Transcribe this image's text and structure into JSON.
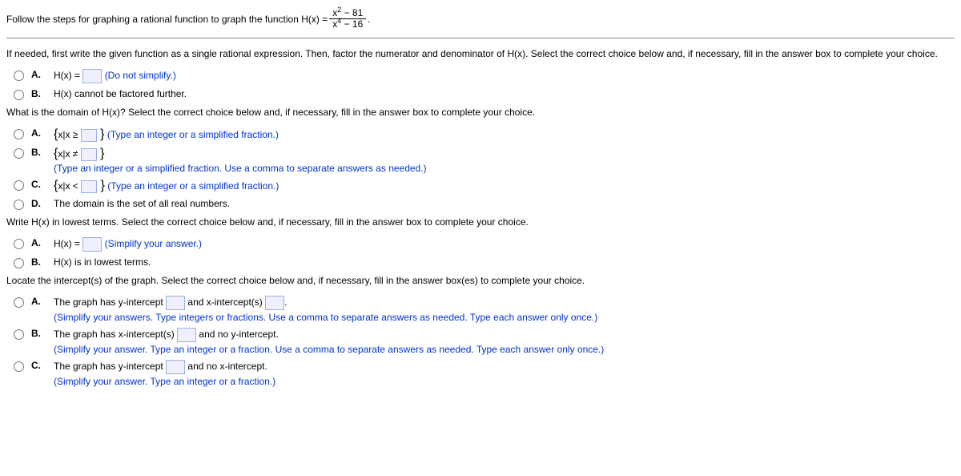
{
  "intro": {
    "lead": "Follow the steps for graphing a rational function to graph the function H(x) =",
    "num": "x",
    "numExp": "2",
    "numTail": " − 81",
    "den": "x",
    "denExp": "4",
    "denTail": " − 16",
    "period": "."
  },
  "q1": {
    "prompt": "If needed, first write the given function as a single rational expression. Then, factor the numerator and denominator of H(x). Select the correct choice below and, if necessary, fill in the answer box to complete your choice.",
    "A": {
      "letter": "A.",
      "pre": "H(x) = ",
      "hint": "(Do not simplify.)"
    },
    "B": {
      "letter": "B.",
      "text": "H(x) cannot be factored further."
    }
  },
  "q2": {
    "prompt": "What is the domain of H(x)? Select the correct choice below and, if necessary, fill in the answer box to complete your choice.",
    "A": {
      "letter": "A.",
      "open": "{",
      "xcond": "x|x ≥ ",
      "close": " }",
      "hint": "(Type an integer or a simplified fraction.)"
    },
    "B": {
      "letter": "B.",
      "open": "{",
      "xcond": "x|x ≠ ",
      "close": " }",
      "hint": "(Type an integer or a simplified fraction. Use a comma to separate answers as needed.)"
    },
    "C": {
      "letter": "C.",
      "open": "{",
      "xcond": "x|x < ",
      "close": " }",
      "hint": "(Type an integer or a simplified fraction.)"
    },
    "D": {
      "letter": "D.",
      "text": "The domain is the set of all real numbers."
    }
  },
  "q3": {
    "prompt": "Write H(x) in lowest terms. Select the correct choice below and, if necessary, fill in the answer box to complete your choice.",
    "A": {
      "letter": "A.",
      "pre": "H(x) = ",
      "hint": "(Simplify your answer.)"
    },
    "B": {
      "letter": "B.",
      "text": "H(x) is in lowest terms."
    }
  },
  "q4": {
    "prompt": "Locate the intercept(s) of the graph. Select the correct choice below and, if necessary, fill in the answer box(es) to complete your choice.",
    "A": {
      "letter": "A.",
      "t1": "The graph has y-intercept ",
      "t2": " and x-intercept(s) ",
      "t3": ".",
      "hint": "(Simplify your answers. Type integers or fractions. Use a comma to separate answers as needed. Type each answer only once.)"
    },
    "B": {
      "letter": "B.",
      "t1": "The graph has x-intercept(s) ",
      "t2": " and no y-intercept.",
      "hint": "(Simplify your answer. Type an integer or a fraction. Use a comma to separate answers as needed. Type each answer only once.)"
    },
    "C": {
      "letter": "C.",
      "t1": "The graph has y-intercept ",
      "t2": " and no x-intercept.",
      "hint": "(Simplify your answer. Type an integer or a fraction.)"
    }
  }
}
